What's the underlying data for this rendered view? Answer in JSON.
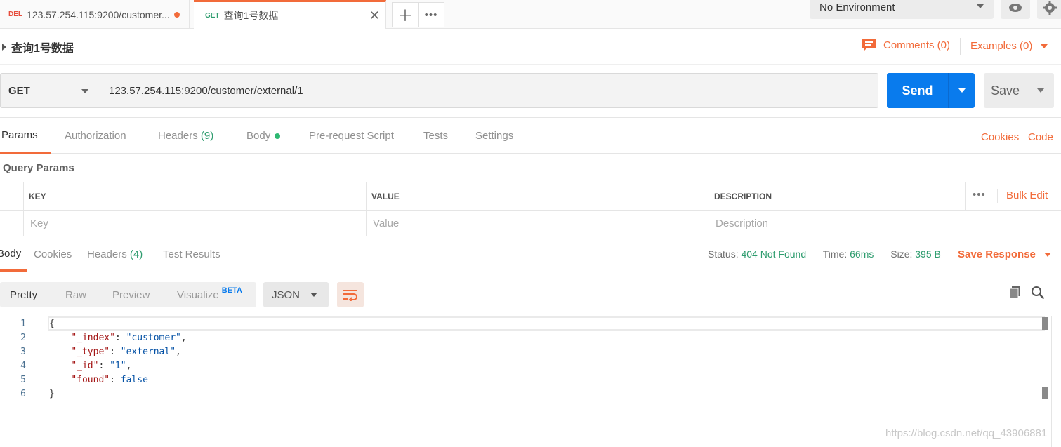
{
  "tabs": [
    {
      "method": "DEL",
      "title": "123.57.254.115:9200/customer..."
    },
    {
      "method": "GET",
      "title": "查询1号数据"
    }
  ],
  "environment": {
    "selected": "No Environment"
  },
  "request": {
    "name": "查询1号数据",
    "method": "GET",
    "url": "123.57.254.115:9200/customer/external/1",
    "comments_label": "Comments (0)",
    "examples_label": "Examples (0)",
    "send_label": "Send",
    "save_label": "Save"
  },
  "request_tabs": {
    "params": "Params",
    "authorization": "Authorization",
    "headers": "Headers",
    "headers_count": "(9)",
    "body": "Body",
    "prerequest": "Pre-request Script",
    "tests": "Tests",
    "settings": "Settings",
    "cookies": "Cookies",
    "code": "Code"
  },
  "query_params": {
    "title": "Query Params",
    "columns": {
      "key": "KEY",
      "value": "VALUE",
      "description": "DESCRIPTION"
    },
    "placeholders": {
      "key": "Key",
      "value": "Value",
      "description": "Description"
    },
    "bulk_edit": "Bulk Edit"
  },
  "response_tabs": {
    "body": "Body",
    "cookies": "Cookies",
    "headers": "Headers",
    "headers_count": "(4)",
    "test_results": "Test Results"
  },
  "response_status": {
    "status_label": "Status:",
    "status_value": "404 Not Found",
    "time_label": "Time:",
    "time_value": "66ms",
    "size_label": "Size:",
    "size_value": "395 B",
    "save_response": "Save Response"
  },
  "view": {
    "pretty": "Pretty",
    "raw": "Raw",
    "preview": "Preview",
    "visualize": "Visualize",
    "beta": "BETA",
    "format": "JSON"
  },
  "code_lines": [
    {
      "n": "1",
      "text": "{"
    },
    {
      "n": "2",
      "key": "\"_index\"",
      "val": "\"customer\"",
      "end": ","
    },
    {
      "n": "3",
      "key": "\"_type\"",
      "val": "\"external\"",
      "end": ","
    },
    {
      "n": "4",
      "key": "\"_id\"",
      "val": "\"1\"",
      "end": ","
    },
    {
      "n": "5",
      "key": "\"found\"",
      "val": "false",
      "end": ""
    },
    {
      "n": "6",
      "text": "}"
    }
  ],
  "watermark": "https://blog.csdn.net/qq_43906881",
  "colors": {
    "accent": "#f26b3a",
    "send": "#097bed",
    "success": "#2e9c6e"
  }
}
